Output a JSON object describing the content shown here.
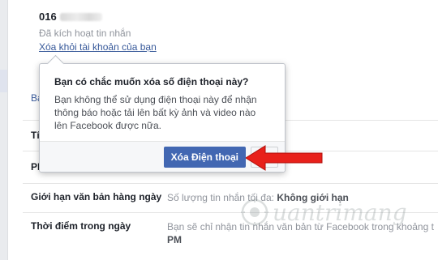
{
  "phone": {
    "number_prefix": "016",
    "status": "Đã kích hoạt tin nhắn",
    "remove_link": "Xóa khỏi tài khoản của bạn"
  },
  "peek": {
    "ba": "Ba",
    "ti": "Tí",
    "pi": "PI"
  },
  "dialog": {
    "title": "Bạn có chắc muốn xóa số điện thoại này?",
    "body": "Bạn không thể sử dụng điện thoại này để nhận thông báo hoặc tải lên bất kỳ ảnh và video nào lên Facebook được nữa.",
    "confirm_label": "Xóa Điện thoại"
  },
  "settings": [
    {
      "label": "Giới hạn văn bản hàng ngày",
      "value_prefix": "Số lượng tin nhắn tối đa:",
      "value_strong": "Không giới hạn"
    },
    {
      "label": "Thời điểm trong ngày",
      "value_prefix": "Bạn sẽ chỉ nhận tin nhắn văn bản từ Facebook trong khoảng t",
      "value_strong": "PM"
    }
  ],
  "watermark": {
    "text": "uantrimang"
  },
  "colors": {
    "accent": "#4267b2",
    "link": "#365899",
    "arrow": "#e8201a"
  },
  "icons": {
    "arrow": "red-arrow-icon",
    "watermark": "quantrimang-logo-icon"
  }
}
